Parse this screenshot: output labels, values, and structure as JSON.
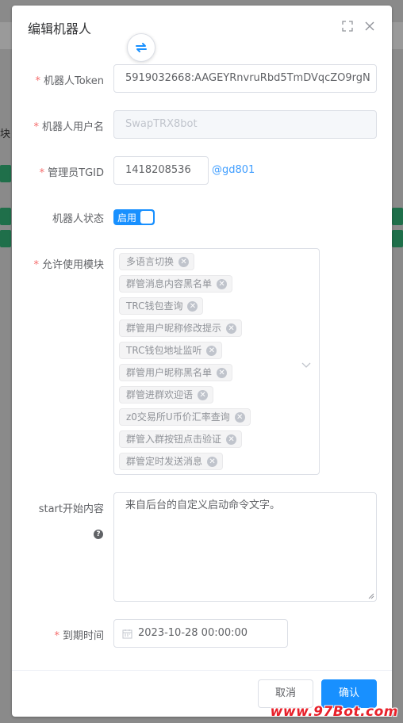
{
  "dialog": {
    "title": "编辑机器人",
    "fullscreen_icon": "fullscreen-icon",
    "close_icon": "close-icon",
    "swap_icon": "swap-icon"
  },
  "form": {
    "token": {
      "label": "机器人Token",
      "required": "*",
      "value": "5919032668:AAGEYRnvruRbd5TmDVqcZO9rgN"
    },
    "username": {
      "label": "机器人用户名",
      "required": "*",
      "placeholder": "SwapTRX8bot"
    },
    "admin": {
      "label": "管理员TGID",
      "required": "*",
      "value": "1418208536",
      "handle": "@gd801"
    },
    "status": {
      "label": "机器人状态",
      "switch_text": "启用",
      "enabled": true
    },
    "modules": {
      "label": "允许使用模块",
      "required": "*",
      "tags": [
        "多语言切换",
        "群管消息内容黑名单",
        "TRC钱包查询",
        "群管用户昵称修改提示",
        "TRC钱包地址监听",
        "群管用户昵称黑名单",
        "群管进群欢迎语",
        "z0交易所U币价汇率查询",
        "群管入群按钮点击验证",
        "群管定时发送消息"
      ]
    },
    "start": {
      "label": "start开始内容",
      "value": "来自后台的自定义启动命令文字。",
      "help_icon": "question-circle-icon"
    },
    "expire": {
      "label": "到期时间",
      "required": "*",
      "value": "2023-10-28 00:00:00",
      "icon": "calendar-icon"
    }
  },
  "footer": {
    "cancel_label": "取消",
    "confirm_label": "确认"
  },
  "background": {
    "left_label": "块"
  },
  "watermark": "www.97Bot.com",
  "colors": {
    "primary": "#1890ff",
    "required": "#f56c6c",
    "link": "#409eff"
  }
}
